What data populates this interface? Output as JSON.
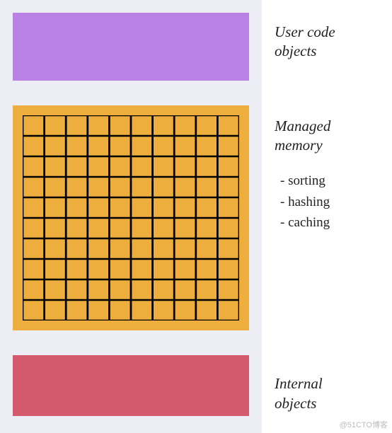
{
  "blocks": {
    "user_code": {
      "label": "User code\nobjects",
      "color": "#b982e4"
    },
    "managed": {
      "label": "Managed\nmemory",
      "color": "#eeae3d",
      "grid_color": "#000000",
      "items": [
        "- sorting",
        "- hashing",
        "- caching"
      ]
    },
    "internal": {
      "label": "Internal\nobjects",
      "color": "#d35a6d"
    }
  },
  "layout": {
    "background": "#edeef5"
  },
  "watermark": "@51CTO博客"
}
